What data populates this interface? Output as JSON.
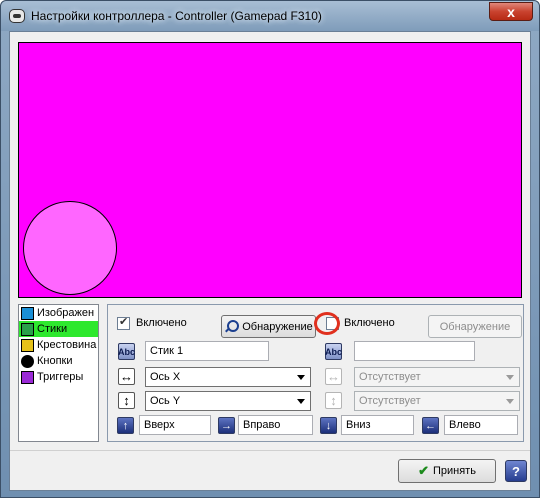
{
  "window": {
    "title": "Настройки контроллера - Controller (Gamepad F310)",
    "close_glyph": "x"
  },
  "nav": {
    "items": [
      {
        "label": "Изображен",
        "icon": "image-icon"
      },
      {
        "label": "Стики",
        "icon": "stick-icon"
      },
      {
        "label": "Крестовина",
        "icon": "dpad-icon"
      },
      {
        "label": "Кнопки",
        "icon": "buttons-icon"
      },
      {
        "label": "Триггеры",
        "icon": "trigger-icon"
      }
    ],
    "selected_index": 1
  },
  "stick_panel": {
    "left": {
      "enabled_label": "Включено",
      "enabled": true,
      "detect_label": "Обнаружение",
      "name_value": "Стик 1",
      "x_axis": "Ось X",
      "y_axis": "Ось Y"
    },
    "right": {
      "enabled_label": "Включено",
      "enabled": false,
      "detect_label": "Обнаружение",
      "name_value": "",
      "x_axis": "Отсутствует",
      "y_axis": "Отсутствует"
    },
    "directions": {
      "up": "Вверх",
      "right": "Вправо",
      "down": "Вниз",
      "left": "Влево"
    },
    "abc_glyph": "Abc"
  },
  "footer": {
    "accept_label": "Принять",
    "help_glyph": "?"
  },
  "colors": {
    "preview_background": "#ff00ff",
    "stick_fill": "#ff66ff",
    "selected_item": "#2ee82e"
  }
}
